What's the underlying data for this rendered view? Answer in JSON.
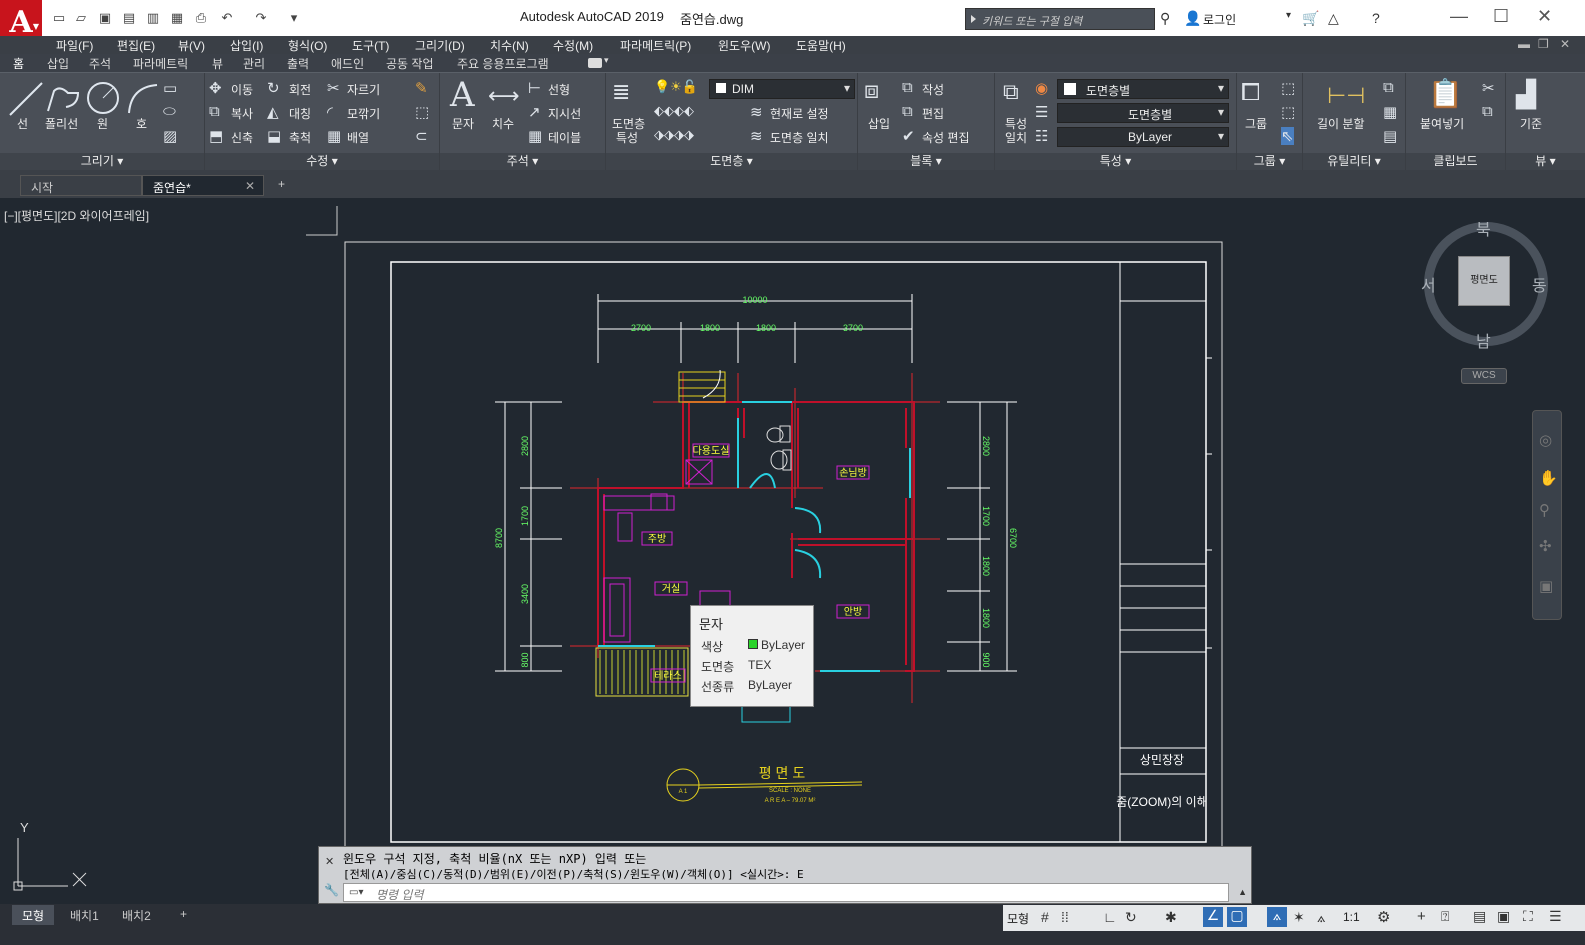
{
  "app": {
    "logo": "A",
    "title": "Autodesk AutoCAD 2019",
    "file": "줌연습.dwg"
  },
  "titlebar": {
    "search_placeholder": "키워드 또는 구절 입력",
    "login": "로그인"
  },
  "menu": [
    "파일(F)",
    "편집(E)",
    "뷰(V)",
    "삽입(I)",
    "형식(O)",
    "도구(T)",
    "그리기(D)",
    "치수(N)",
    "수정(M)",
    "파라메트릭(P)",
    "윈도우(W)",
    "도움말(H)"
  ],
  "ribbon_tabs": [
    "홈",
    "삽입",
    "주석",
    "파라메트릭",
    "뷰",
    "관리",
    "출력",
    "애드인",
    "공동 작업",
    "주요 응용프로그램"
  ],
  "ribbon": {
    "draw": {
      "line": "선",
      "polyline": "폴리선",
      "circle": "원",
      "arc": "호",
      "title": "그리기"
    },
    "modify": {
      "move": "이동",
      "rotate": "회전",
      "trim": "자르기",
      "copy": "복사",
      "mirror": "대칭",
      "fillet": "모깎기",
      "stretch": "신축",
      "scale": "축척",
      "array": "배열",
      "title": "수정"
    },
    "annotation": {
      "text": "문자",
      "dimension": "치수",
      "linear": "선형",
      "leader": "지시선",
      "table": "테이블",
      "title": "주석"
    },
    "layers": {
      "props": "도면층",
      "props2": "특성",
      "current": "DIM",
      "set_current": "현재로 설정",
      "match": "도면층 일치",
      "title": "도면층"
    },
    "block": {
      "insert": "삽입",
      "create": "작성",
      "edit": "편집",
      "edit_attr": "속성 편집",
      "title": "블록"
    },
    "properties": {
      "match": "특성",
      "match2": "일치",
      "color": "도면층별",
      "linetype": "도면층별",
      "lineweight": "ByLayer",
      "title": "특성"
    },
    "groups": {
      "group": "그룹",
      "title": "그룹"
    },
    "utilities": {
      "measure": "길이 분할",
      "title": "유틸리티"
    },
    "clipboard": {
      "paste": "붙여넣기",
      "title": "클립보드"
    },
    "view": {
      "base": "기준",
      "title": "뷰"
    }
  },
  "doc_tabs": [
    "시작",
    "줌연습*"
  ],
  "viewport_label": "[−][평면도][2D 와이어프레임]",
  "drawing": {
    "dims_top": [
      "10000",
      "2700",
      "1800",
      "1800",
      "3700"
    ],
    "dims_left": [
      "2800",
      "1700",
      "3400",
      "800",
      "8700"
    ],
    "dims_right": [
      "2800",
      "1700",
      "1800",
      "1800",
      "900",
      "6700"
    ],
    "rooms": [
      "다용도실",
      "손님방",
      "주방",
      "거실",
      "안방",
      "테라스"
    ],
    "title": "평 면 도",
    "scale": "SCALE : NONE",
    "area": "A R E A – 79.07 M²",
    "section_mark": "A 1",
    "titleblock_1": "상민장장",
    "titleblock_2": "줌(ZOOM)의 이해"
  },
  "tooltip": {
    "title": "문자",
    "rows": [
      {
        "k": "색상",
        "v": "ByLayer"
      },
      {
        "k": "도면층",
        "v": "TEX"
      },
      {
        "k": "선종류",
        "v": "ByLayer"
      }
    ]
  },
  "viewcube": {
    "north": "북",
    "south": "남",
    "east": "동",
    "west": "서",
    "face": "평면도",
    "wcs": "WCS"
  },
  "ucs": {
    "y": "Y"
  },
  "command": {
    "line1": "윈도우 구석 지정, 축척 비율(nX 또는 nXP) 입력 또는",
    "line2": "[전체(A)/중심(C)/동적(D)/범위(E)/이전(P)/축척(S)/윈도우(W)/객체(O)] <실시간>: E",
    "placeholder": "명령 입력"
  },
  "layout_tabs": [
    "모형",
    "배치1",
    "배치2"
  ],
  "status": {
    "model": "모형",
    "scale": "1:1"
  }
}
